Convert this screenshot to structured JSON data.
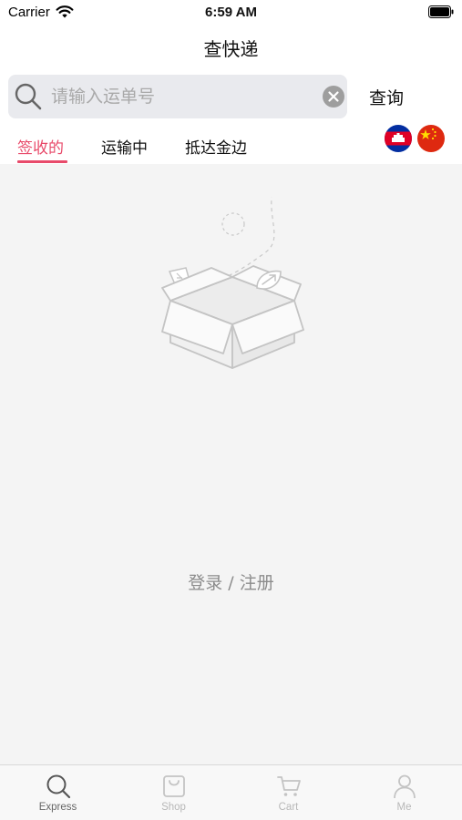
{
  "status_bar": {
    "carrier": "Carrier",
    "time": "6:59 AM"
  },
  "nav": {
    "title": "查快递"
  },
  "search": {
    "placeholder": "请输入运单号",
    "value": "",
    "query_label": "查询"
  },
  "tabs": [
    {
      "label": "签收的",
      "active": true
    },
    {
      "label": "运输中",
      "active": false
    },
    {
      "label": "抵达金边",
      "active": false
    }
  ],
  "flags": [
    {
      "name": "cambodia-flag-icon"
    },
    {
      "name": "china-flag-icon"
    }
  ],
  "empty_state": {
    "login_label": "登录 / 注册"
  },
  "tabbar": [
    {
      "label": "Express",
      "icon": "search-icon",
      "active": true
    },
    {
      "label": "Shop",
      "icon": "bag-icon",
      "active": false
    },
    {
      "label": "Cart",
      "icon": "cart-icon",
      "active": false
    },
    {
      "label": "Me",
      "icon": "person-icon",
      "active": false
    }
  ],
  "colors": {
    "accent": "#e84a6a",
    "content_bg": "#f4f4f4",
    "search_bg": "#e9eaee",
    "inactive": "#b8b8b8"
  }
}
